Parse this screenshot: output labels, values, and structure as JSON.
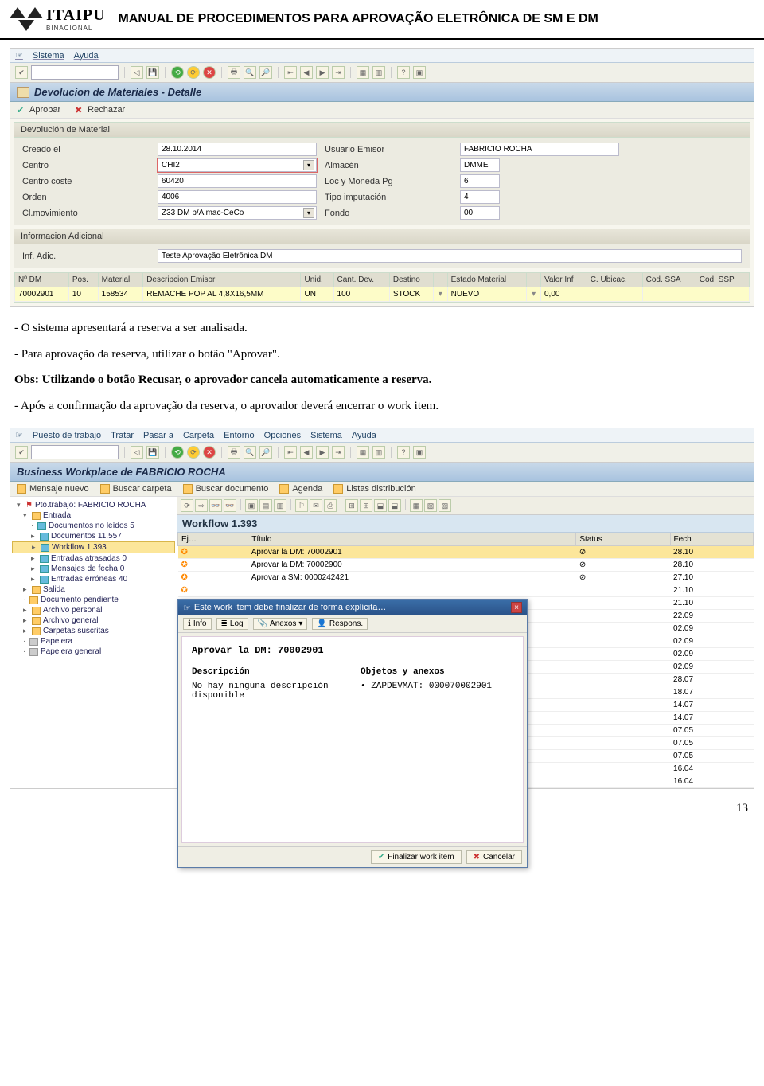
{
  "header": {
    "logo_text": "ITAIPU",
    "logo_sub": "BINACIONAL",
    "title": "MANUAL DE PROCEDIMENTOS PARA APROVAÇÃO ELETRÔNICA DE SM E DM"
  },
  "shot1": {
    "menubar": [
      "Sistema",
      "Ayuda"
    ],
    "window_title": "Devolucion de Materiales - Detalle",
    "actions": {
      "approve": "Aprobar",
      "reject": "Rechazar"
    },
    "panel1_title": "Devolución de Material",
    "panel2_title": "Informacion Adicional",
    "fields": {
      "creado_el": {
        "label": "Creado el",
        "value": "28.10.2014"
      },
      "centro": {
        "label": "Centro",
        "value": "CHI2"
      },
      "centro_coste": {
        "label": "Centro coste",
        "value": "60420"
      },
      "orden": {
        "label": "Orden",
        "value": "4006"
      },
      "cl_mov": {
        "label": "Cl.movimiento",
        "value": "Z33 DM p/Almac-CeCo"
      },
      "usuario": {
        "label": "Usuario Emisor",
        "value": "FABRICIO ROCHA"
      },
      "almacen": {
        "label": "Almacén",
        "value": "DMME"
      },
      "loc_mon": {
        "label": "Loc y Moneda Pg",
        "value": "6"
      },
      "tipo_imp": {
        "label": "Tipo imputación",
        "value": "4"
      },
      "fondo": {
        "label": "Fondo",
        "value": "00"
      },
      "inf_adic": {
        "label": "Inf. Adic.",
        "value": "Teste Aprovação Eletrônica DM"
      }
    },
    "table": {
      "headers": [
        "Nº DM",
        "Pos.",
        "Material",
        "Descripcion Emisor",
        "Unid.",
        "Cant. Dev.",
        "Destino",
        "",
        "Estado Material",
        "",
        "Valor Inf",
        "C. Ubicac.",
        "Cod. SSA",
        "Cod. SSP"
      ],
      "row": [
        "70002901",
        "10",
        "158534",
        "REMACHE POP AL 4,8X16,5MM",
        "UN",
        "100",
        "STOCK",
        "",
        "NUEVO",
        "",
        "0,00",
        "",
        "",
        ""
      ]
    }
  },
  "body_text": {
    "p1": "- O sistema apresentará a reserva a ser analisada.",
    "p2": "- Para aprovação da reserva, utilizar o botão \"Aprovar\".",
    "p3": "Obs: Utilizando o botão Recusar, o aprovador cancela automaticamente a reserva.",
    "p4": "- Após a confirmação da aprovação da reserva, o aprovador deverá encerrar o work item."
  },
  "shot2": {
    "menubar": [
      "Puesto de trabajo",
      "Tratar",
      "Pasar a",
      "Carpeta",
      "Entorno",
      "Opciones",
      "Sistema",
      "Ayuda"
    ],
    "window_title": "Business Workplace de FABRICIO ROCHA",
    "toolbar2": [
      "Mensaje nuevo",
      "Buscar carpeta",
      "Buscar documento",
      "Agenda",
      "Listas distribución"
    ],
    "tree": {
      "root": "Pto.trabajo: FABRICIO ROCHA",
      "entrada": "Entrada",
      "items": [
        "Documentos no leídos 5",
        "Documentos 11.557",
        "Workflow 1.393",
        "Entradas atrasadas 0",
        "Mensajes de fecha 0",
        "Entradas erróneas 40"
      ],
      "other": [
        "Salida",
        "Documento pendiente",
        "Archivo personal",
        "Archivo general",
        "Carpetas suscritas",
        "Papelera",
        "Papelera general"
      ]
    },
    "rp_title": "Workflow 1.393",
    "wf_headers": [
      "Ej…",
      "Título",
      "Status",
      "Fech"
    ],
    "wf_rows": [
      {
        "t": "Aprovar la DM: 70002901",
        "s": "⊘",
        "sel": true,
        "d": "28.10"
      },
      {
        "t": "Aprovar la DM: 70002900",
        "s": "⊘",
        "d": "28.10"
      },
      {
        "t": "Aprovar a SM: 0000242421",
        "s": "⊘",
        "d": "27.10"
      },
      {
        "t": "",
        "s": "",
        "d": "21.10"
      },
      {
        "t": "",
        "s": "",
        "d": "21.10"
      },
      {
        "t": "",
        "s": "",
        "d": "22.09"
      },
      {
        "t": "",
        "s": "",
        "d": "02.09"
      },
      {
        "t": "",
        "s": "",
        "d": "02.09"
      },
      {
        "t": "",
        "s": "",
        "d": "02.09"
      },
      {
        "t": "",
        "s": "",
        "d": "02.09"
      },
      {
        "t": "",
        "s": "",
        "d": "28.07"
      },
      {
        "t": "",
        "s": "",
        "d": "18.07"
      },
      {
        "t": "",
        "s": "",
        "d": "14.07"
      },
      {
        "t": "",
        "s": "",
        "d": "14.07"
      },
      {
        "t": "",
        "s": "",
        "d": "07.05"
      },
      {
        "t": "",
        "s": "",
        "d": "07.05"
      },
      {
        "t": "",
        "s": "",
        "d": "07.05"
      },
      {
        "t": "",
        "s": "",
        "d": "16.04"
      },
      {
        "t": "",
        "s": "",
        "d": "16.04"
      }
    ],
    "dialog": {
      "title": "Este work item debe finalizar de forma explícita…",
      "toolbar": [
        "Info",
        "Log",
        "Anexos",
        "Respons."
      ],
      "main": "Aprovar la DM: 70002901",
      "desc_h": "Descripción",
      "desc_t": "No hay ninguna descripción disponible",
      "obj_h": "Objetos y anexos",
      "obj_t": "ZAPDEVMAT: 000070002901",
      "btn_finish": "Finalizar work item",
      "btn_cancel": "Cancelar"
    }
  },
  "page_num": "13"
}
